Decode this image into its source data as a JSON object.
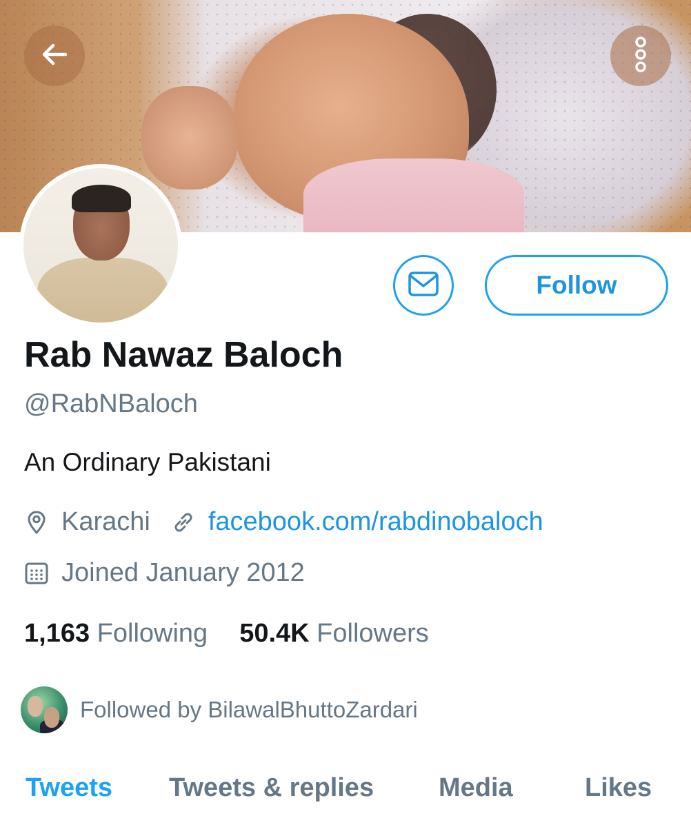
{
  "banner": {
    "alt": "Profile header image of a sleeping baby"
  },
  "profile": {
    "name": "Rab Nawaz Baloch",
    "handle": "@RabNBaloch",
    "bio": "An Ordinary Pakistani",
    "location": "Karachi",
    "website": "facebook.com/rabdinobaloch",
    "joined": "Joined January 2012"
  },
  "actions": {
    "follow_label": "Follow"
  },
  "stats": {
    "following_count": "1,163",
    "following_label": "Following",
    "followers_count": "50.4K",
    "followers_label": "Followers"
  },
  "followed_by": {
    "text": "Followed by BilawalBhuttoZardari"
  },
  "tabs": [
    {
      "label": "Tweets",
      "active": true
    },
    {
      "label": "Tweets & replies",
      "active": false
    },
    {
      "label": "Media",
      "active": false
    },
    {
      "label": "Likes",
      "active": false
    }
  ],
  "colors": {
    "accent": "#1da1f2",
    "secondary_text": "#657786",
    "primary_text": "#14171a"
  },
  "icons": [
    "back-arrow-icon",
    "more-vertical-icon",
    "mail-icon",
    "location-pin-icon",
    "link-icon",
    "calendar-icon"
  ]
}
